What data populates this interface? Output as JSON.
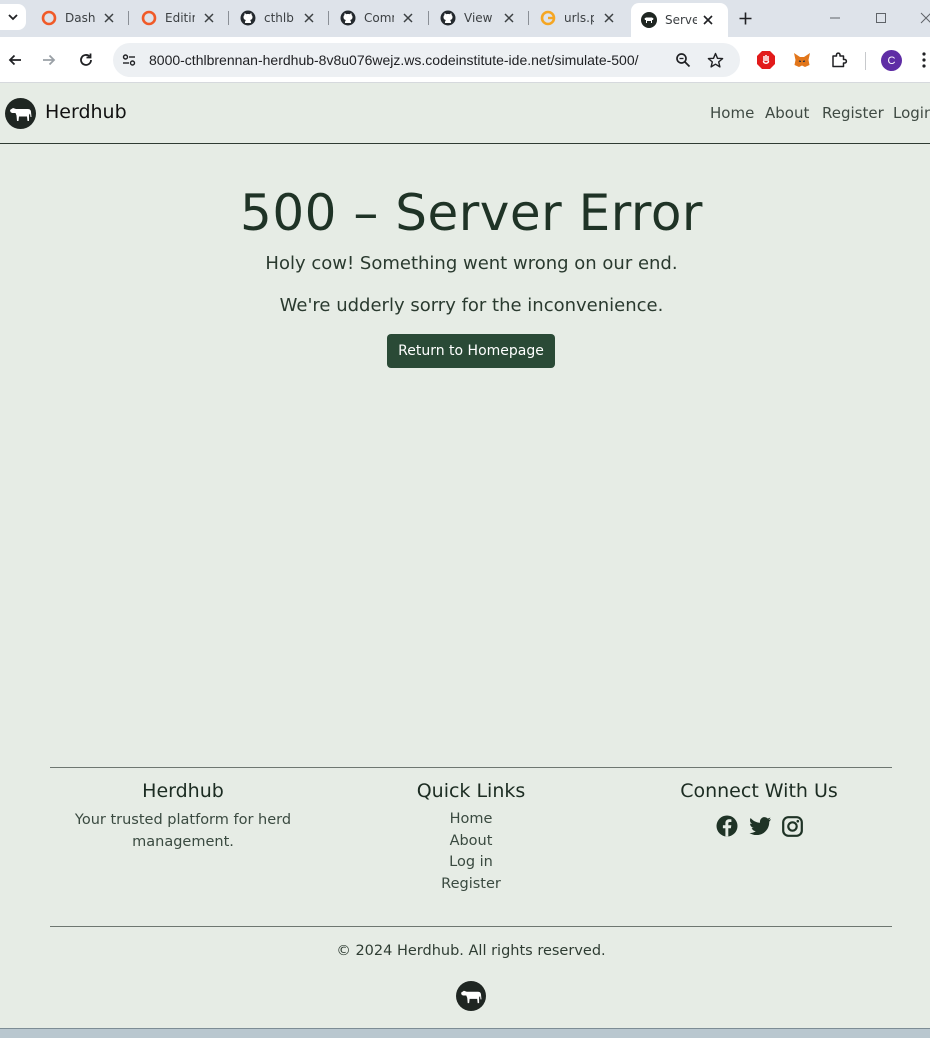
{
  "browser": {
    "tabs": [
      {
        "label": "Dashb",
        "icon": "openai-icon"
      },
      {
        "label": "Editin",
        "icon": "openai-icon"
      },
      {
        "label": "cthlbr",
        "icon": "github-icon"
      },
      {
        "label": "Comn",
        "icon": "github-icon"
      },
      {
        "label": "View",
        "icon": "github-icon"
      },
      {
        "label": "urls.p",
        "icon": "google-icon"
      },
      {
        "label": "Serve",
        "icon": "cow-icon",
        "active": true
      }
    ],
    "url": "8000-cthlbrennan-herdhub-8v8u076wejz.ws.codeinstitute-ide.net/simulate-500/",
    "profile_initial": "C"
  },
  "site": {
    "brand": "Herdhub",
    "nav": [
      "Home",
      "About",
      "Register",
      "Login"
    ]
  },
  "main": {
    "title": "500 – Server Error",
    "line1": "Holy cow! Something went wrong on our end.",
    "line2": "We're udderly sorry for the inconvenience.",
    "button": "Return to Homepage"
  },
  "footer": {
    "about_title": "Herdhub",
    "about_line1": "Your trusted platform for herd",
    "about_line2": "management.",
    "links_title": "Quick Links",
    "links": [
      "Home",
      "About",
      "Log in",
      "Register"
    ],
    "connect_title": "Connect With Us",
    "social": [
      "facebook-icon",
      "twitter-icon",
      "instagram-icon"
    ],
    "copyright": "© 2024 Herdhub. All rights reserved."
  },
  "colors": {
    "page_bg": "#e6ece5",
    "accent": "#2a4a36",
    "text_dark": "#1f3326"
  }
}
